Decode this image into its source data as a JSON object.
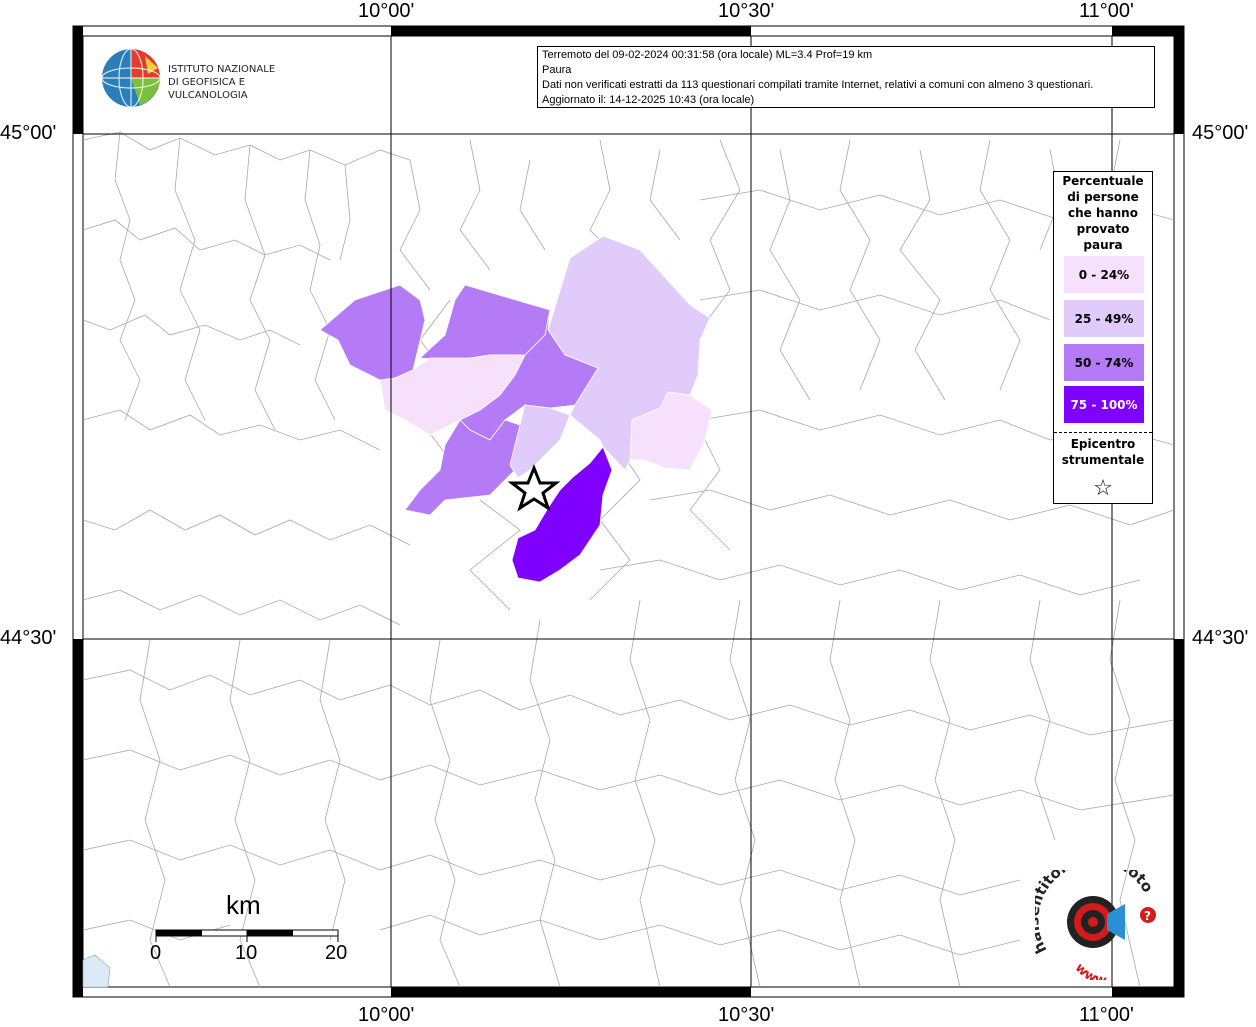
{
  "map": {
    "lon_labels": [
      "10°00'",
      "10°30'",
      "11°00'"
    ],
    "lat_labels": [
      "45°00'",
      "44°30'"
    ]
  },
  "info_box": {
    "line1": "Terremoto del 09-02-2024 00:31:58 (ora locale) ML=3.4 Prof=19 km",
    "line2": "Paura",
    "line3": "Dati non verificati estratti da 113 questionari compilati tramite Internet, relativi a comuni con almeno 3 questionari.",
    "line4": "Aggiornato il: 14-12-2025 10:43 (ora locale)"
  },
  "logo": {
    "line1": "ISTITUTO NAZIONALE",
    "line2": "DI GEOFISICA E VULCANOLOGIA"
  },
  "legend": {
    "title_lines": [
      "Percentuale",
      "di persone",
      "che hanno",
      "provato",
      "paura"
    ],
    "items": [
      {
        "label": "0 - 24%",
        "color": "#f7e0fb"
      },
      {
        "label": "25 - 49%",
        "color": "#e0cbfa"
      },
      {
        "label": "50 - 74%",
        "color": "#b57af5"
      },
      {
        "label": "75 - 100%",
        "color": "#7f00ff"
      }
    ],
    "epicenter_lines": [
      "Epicentro",
      "strumentale"
    ],
    "epicenter_symbol": "☆"
  },
  "scale": {
    "unit": "km",
    "ticks": [
      "0",
      "10",
      "20"
    ]
  },
  "hst": {
    "text": "haisentitoilterremoto.it",
    "www": "www."
  }
}
